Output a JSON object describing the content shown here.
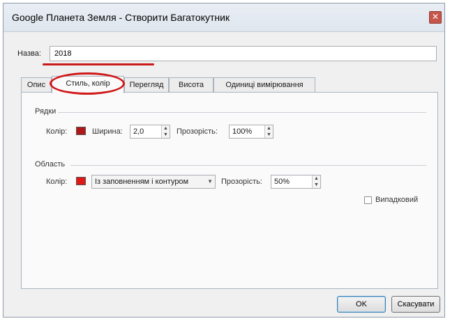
{
  "window": {
    "title": "Google Планета Земля - Створити Багатокутник",
    "close_glyph": "✕"
  },
  "name_field": {
    "label": "Назва:",
    "value": "2018"
  },
  "tabs": [
    {
      "label": "Опис"
    },
    {
      "label": "Стиль, колір",
      "active": true
    },
    {
      "label": "Перегляд"
    },
    {
      "label": "Висота"
    },
    {
      "label": "Одиниці вимірювання"
    }
  ],
  "lines_group": {
    "title": "Рядки",
    "color_label": "Колір:",
    "color": "#b01818",
    "width_label": "Ширина:",
    "width_value": "2,0",
    "opacity_label": "Прозорість:",
    "opacity_value": "100%"
  },
  "area_group": {
    "title": "Область",
    "color_label": "Колір:",
    "color": "#e01818",
    "fill_mode": "Із заповненням і контуром",
    "opacity_label": "Прозорість:",
    "opacity_value": "50%"
  },
  "random_checkbox": {
    "label": "Випадковий",
    "checked": false
  },
  "buttons": {
    "ok": "OK",
    "cancel": "Скасувати"
  },
  "icons": {
    "spin_up": "▲",
    "spin_down": "▼",
    "dropdown": "▼"
  }
}
